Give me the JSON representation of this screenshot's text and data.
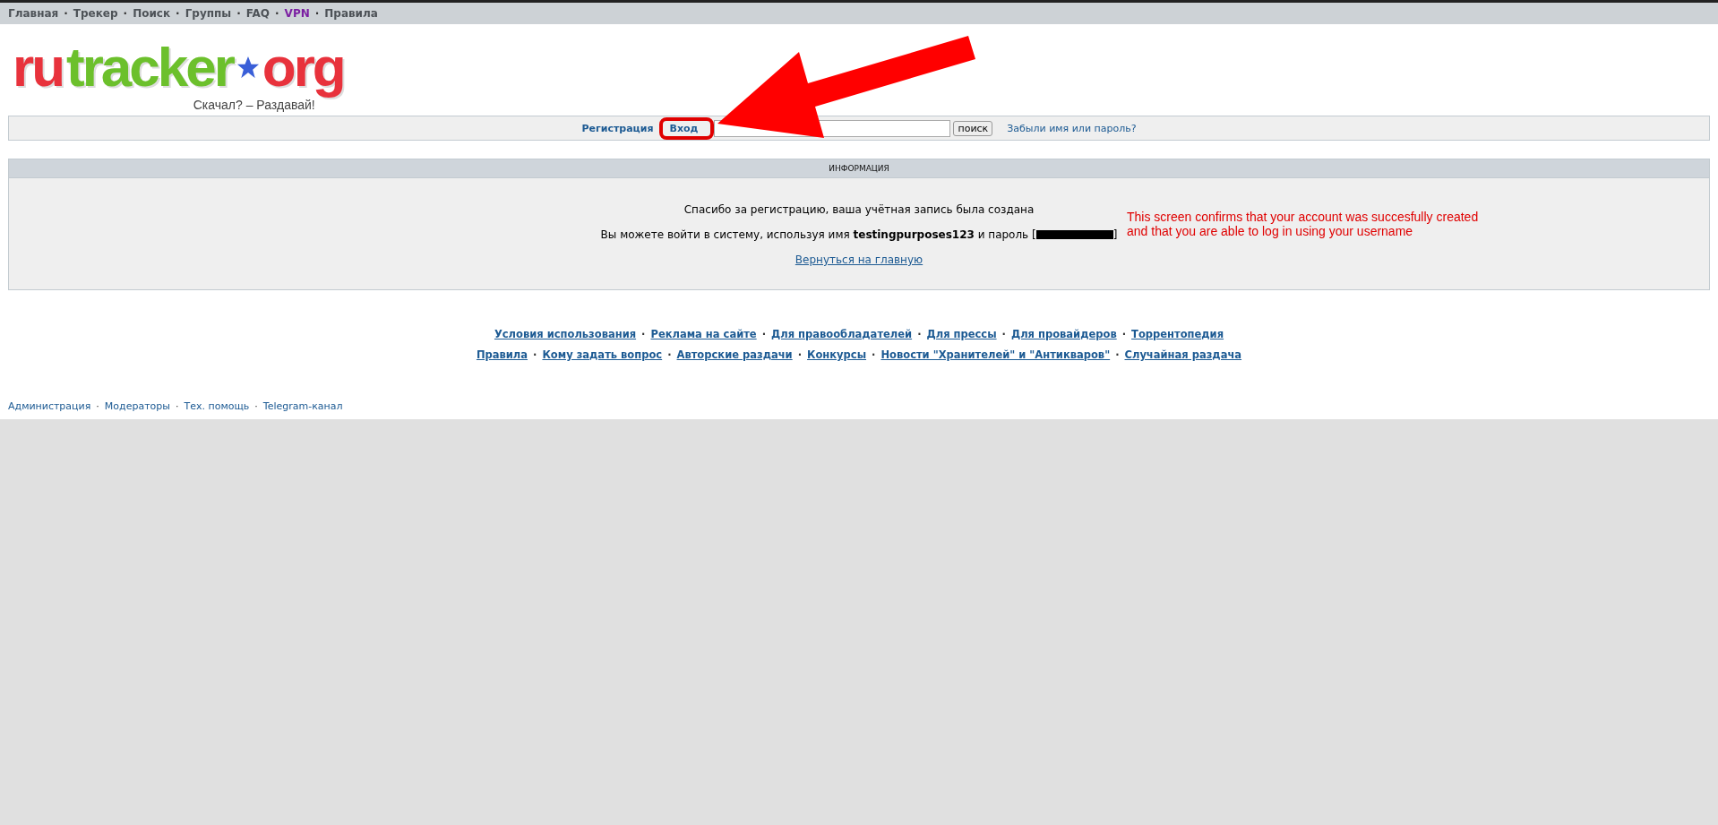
{
  "nav": {
    "separator": "·",
    "items": [
      {
        "label": "Главная",
        "color": "#4d5257"
      },
      {
        "label": "Трекер",
        "color": "#4d5257"
      },
      {
        "label": "Поиск",
        "color": "#4d5257"
      },
      {
        "label": "Группы",
        "color": "#4d5257"
      },
      {
        "label": "FAQ",
        "color": "#4d5257"
      },
      {
        "label": "VPN",
        "color": "#7b1fa2"
      },
      {
        "label": "Правила",
        "color": "#4d5257"
      }
    ]
  },
  "logo": {
    "parts": [
      {
        "text": "ru",
        "color": "#e8323c"
      },
      {
        "text": "tracker",
        "color": "#6cc02c"
      },
      {
        "text": "org",
        "color": "#e8323c"
      }
    ],
    "tagline": "Скачал? – Раздавай!"
  },
  "login_bar": {
    "register_link": "Регистрация",
    "login_link": {
      "label": "Вход",
      "highlighted": true
    },
    "search_button": "поиск",
    "forgot_link": "Забыли имя или пароль?"
  },
  "info": {
    "title": "ИНФОРМАЦИЯ",
    "message": "Спасибо за регистрацию, ваша учётная запись была создана",
    "login_line": {
      "before": "Вы можете войти в систему, используя имя **testingpurposes123** и пароль [",
      "after": "]"
    },
    "home_link": "Вернуться на главную"
  },
  "annotation": {
    "arrow": true,
    "lines": [
      "This screen confirms that your account was succesfully created",
      "and that you are able to log in using your username"
    ]
  },
  "footer": {
    "separator": "·",
    "lines": [
      {
        "links": [
          "Условия использования",
          "Реклама на сайте",
          "Для правообладателей",
          "Для прессы",
          "Для провайдеров",
          "Торрентопедия"
        ]
      },
      {
        "links": [
          "Правила",
          "Кому задать вопрос",
          "Авторские раздачи",
          "Конкурсы",
          "Новости \"Хранителей\" и \"Антикваров\"",
          "Случайная раздача"
        ]
      }
    ]
  },
  "bottom_links": {
    "separator": "·",
    "items": [
      "Администрация",
      "Модераторы",
      "Тех. помощь",
      "Telegram-канал"
    ]
  }
}
